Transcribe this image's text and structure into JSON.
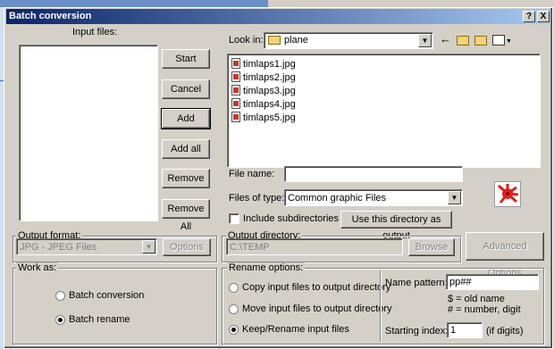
{
  "title": "Batch conversion",
  "title_buttons": {
    "help": "?",
    "close": "X"
  },
  "input_files_label": "Input files:",
  "buttons": {
    "start": "Start",
    "cancel": "Cancel",
    "add": "Add",
    "add_all": "Add all",
    "remove": "Remove",
    "remove_all": "Remove All"
  },
  "browser": {
    "look_in_label": "Look in:",
    "look_in_value": "plane",
    "files": [
      "timlaps1.jpg",
      "timlaps2.jpg",
      "timlaps3.jpg",
      "timlaps4.jpg",
      "timlaps5.jpg"
    ],
    "file_name_label": "File name:",
    "file_name_value": "",
    "files_of_type_label": "Files of type:",
    "files_of_type_value": "Common graphic Files",
    "include_subdirs_label": "Include subdirectories",
    "include_subdirs_checked": false,
    "use_dir_button": "Use this directory as output"
  },
  "output_format": {
    "label": "Output format:",
    "value": "JPG - JPEG Files",
    "options_button": "Options"
  },
  "output_directory": {
    "label": "Output directory:",
    "value": "C:\\TEMP",
    "browse_button": "Browse"
  },
  "advanced_button": "Advanced Options",
  "work_as": {
    "label": "Work as:",
    "options": [
      "Batch conversion",
      "Batch rename"
    ],
    "selected": "Batch rename"
  },
  "rename_options": {
    "label": "Rename options:",
    "options": [
      "Copy input files to output directory",
      "Move input files to output directory",
      "Keep/Rename input files"
    ],
    "selected": "Keep/Rename input files",
    "name_pattern_label": "Name pattern:",
    "name_pattern_value": "pp##",
    "help_line1": "$ = old name",
    "help_line2": "# = number, digit",
    "starting_index_label": "Starting index:",
    "starting_index_value": "1",
    "digits_hint": "(if digits)"
  },
  "icons": [
    "help-icon",
    "close-icon",
    "folder-icon",
    "back-arrow-icon",
    "up-folder-icon",
    "new-folder-icon",
    "view-menu-icon",
    "file-image-icon",
    "app-logo-icon"
  ],
  "colors": {
    "title_start": "#0a246a",
    "title_end": "#a6caf0",
    "face": "#d4d0c8",
    "logo": "#e02020"
  }
}
